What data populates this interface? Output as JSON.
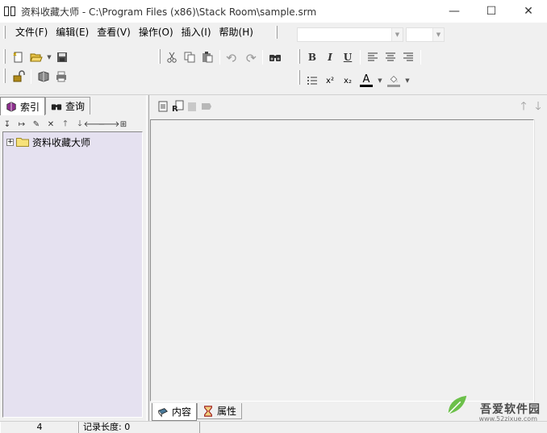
{
  "window": {
    "title": "资料收藏大师 - C:\\Program Files (x86)\\Stack Room\\sample.srm",
    "minimize": "—",
    "maximize": "☐",
    "close": "✕"
  },
  "menu": {
    "items": [
      {
        "label": "文件(F)"
      },
      {
        "label": "编辑(E)"
      },
      {
        "label": "查看(V)"
      },
      {
        "label": "操作(O)"
      },
      {
        "label": "插入(I)"
      },
      {
        "label": "帮助(H)"
      }
    ]
  },
  "format_toolbar": {
    "bold": "B",
    "italic": "I",
    "underline": "U",
    "superscript": "x²",
    "subscript": "x₂",
    "font_color": "A"
  },
  "left_panel": {
    "tabs": [
      {
        "label": "索引",
        "icon": "book-stack-icon"
      },
      {
        "label": "查询",
        "icon": "binoculars-icon"
      }
    ],
    "tree": {
      "root": {
        "label": "资料收藏大师",
        "expander": "+"
      }
    }
  },
  "right_panel": {
    "bottom_tabs": [
      {
        "label": "内容",
        "icon": "book-icon"
      },
      {
        "label": "属性",
        "icon": "hourglass-icon"
      }
    ]
  },
  "statusbar": {
    "count": "4",
    "record_length": "记录长度: 0"
  },
  "watermark": {
    "text": "吾爱软件园",
    "url": "www.52zixue.com"
  }
}
